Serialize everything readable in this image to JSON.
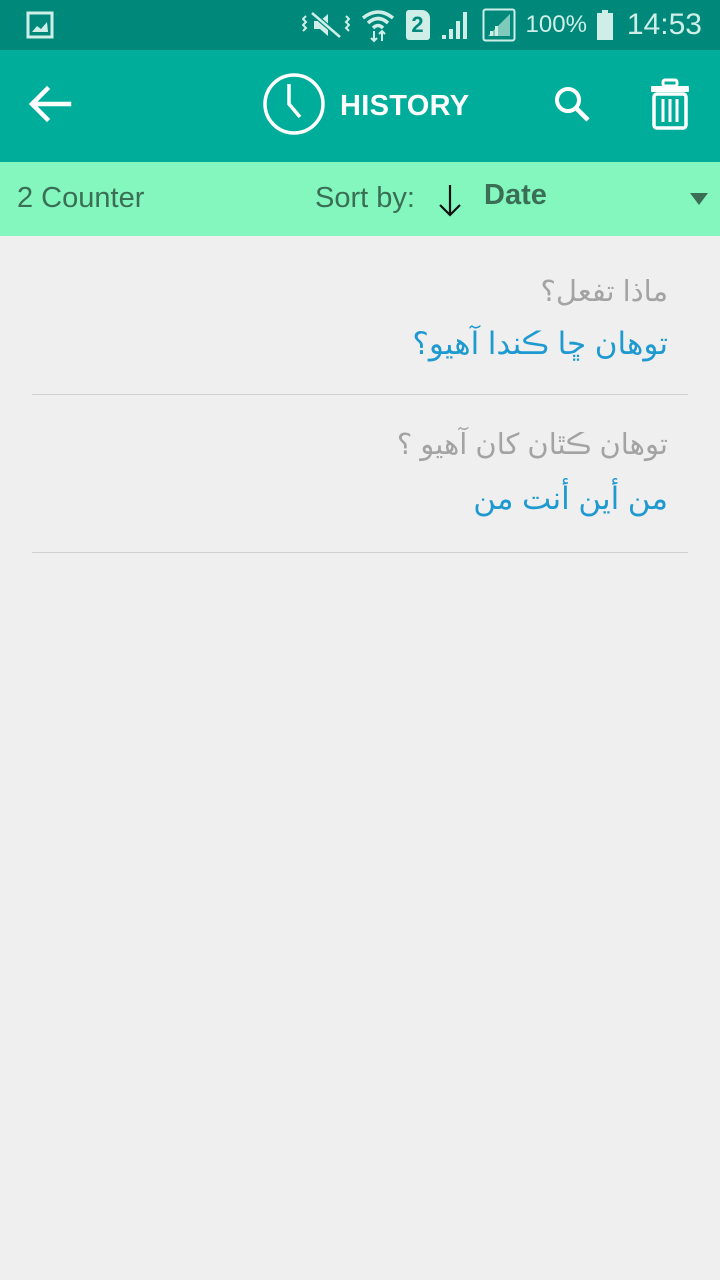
{
  "status_bar": {
    "left_icon": "gallery-notification-icon",
    "icons": [
      "vibrate-mute-icon",
      "wifi-data-icon",
      "sim2-icon",
      "signal-icon",
      "signal-roaming-icon",
      "battery-icon"
    ],
    "sim_label": "2",
    "battery": "100%",
    "time": "14:53"
  },
  "app_bar": {
    "title": "HISTORY",
    "back_icon": "arrow-left-icon",
    "title_icon": "clock-icon",
    "search_icon": "search-icon",
    "delete_icon": "trash-icon",
    "background": "#00ad9a"
  },
  "sort_bar": {
    "counter": "2 Counter",
    "sort_label": "Sort by:",
    "sort_direction_icon": "arrow-down-icon",
    "sort_value": "Date",
    "background": "#84f7bf"
  },
  "history": [
    {
      "source": "ماذا تفعل؟",
      "translation": "توهان ڇا ڪندا آهيو؟"
    },
    {
      "source": "توهان ڪٿان کان آهيو ؟",
      "translation": "من أين أنت من"
    }
  ],
  "colors": {
    "source_text": "#a3a3a3",
    "translation_text": "#1e9ad0"
  }
}
